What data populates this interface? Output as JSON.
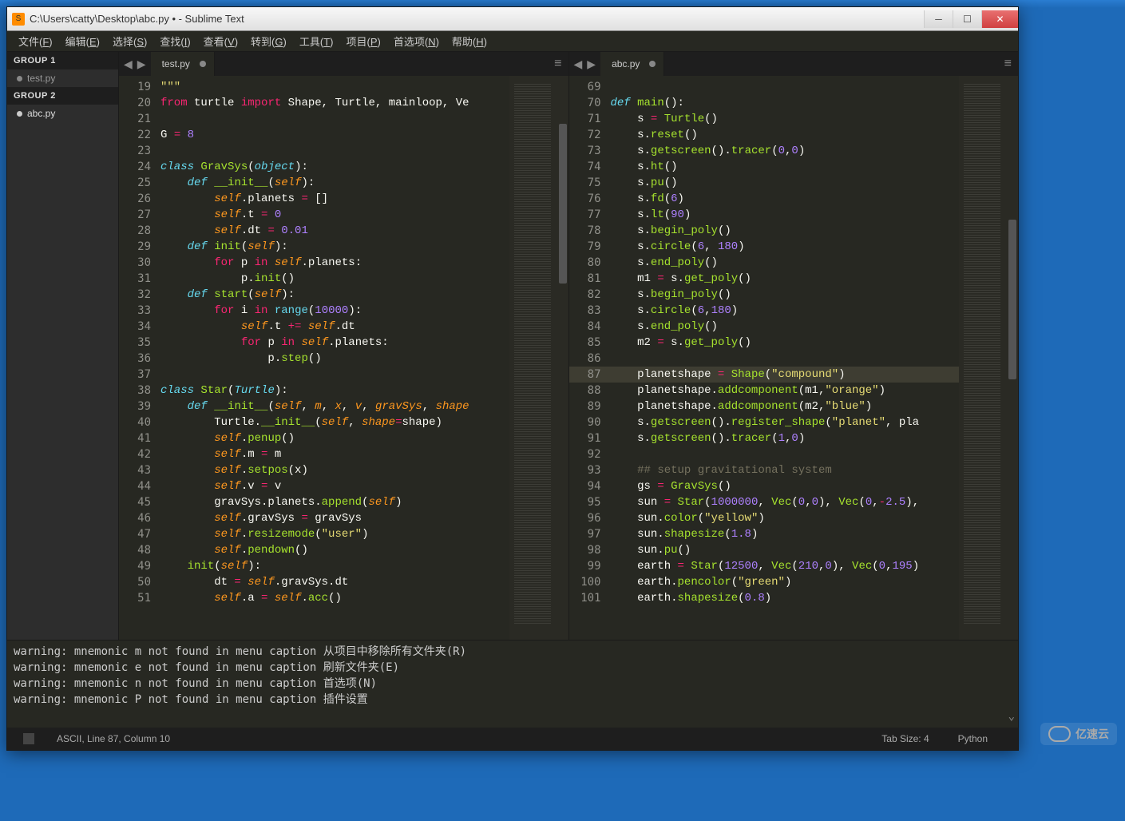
{
  "window": {
    "title": "C:\\Users\\catty\\Desktop\\abc.py • - Sublime Text"
  },
  "menubar": [
    {
      "label": "文件(F)",
      "u": "F"
    },
    {
      "label": "编辑(E)",
      "u": "E"
    },
    {
      "label": "选择(S)",
      "u": "S"
    },
    {
      "label": "查找(I)",
      "u": "I"
    },
    {
      "label": "查看(V)",
      "u": "V"
    },
    {
      "label": "转到(G)",
      "u": "G"
    },
    {
      "label": "工具(T)",
      "u": "T"
    },
    {
      "label": "项目(P)",
      "u": "P"
    },
    {
      "label": "首选项(N)",
      "u": "N"
    },
    {
      "label": "帮助(H)",
      "u": "H"
    }
  ],
  "sidebar": {
    "group1_label": "GROUP 1",
    "group2_label": "GROUP 2",
    "group1_files": [
      {
        "name": "test.py",
        "active": false
      }
    ],
    "group2_files": [
      {
        "name": "abc.py",
        "active": true
      }
    ]
  },
  "panes": [
    {
      "tab": "test.py",
      "first_line": 19,
      "highlight_line": null,
      "lines": [
        {
          "n": 19,
          "html": "<span class='str'>\"\"\"</span>"
        },
        {
          "n": 20,
          "html": "<span class='kw'>from</span> <span class='id'>turtle</span> <span class='kw'>import</span> <span class='id'>Shape, Turtle, mainloop, Ve</span>"
        },
        {
          "n": 21,
          "html": ""
        },
        {
          "n": 22,
          "html": "<span class='id'>G</span> <span class='op'>=</span> <span class='num'>8</span>"
        },
        {
          "n": 23,
          "html": ""
        },
        {
          "n": 24,
          "html": "<span class='kw2'>class</span> <span class='cls'>GravSys</span>(<span class='type'>object</span>):"
        },
        {
          "n": 25,
          "html": "    <span class='kw2'>def</span> <span class='fn'>__init__</span>(<span class='self'>self</span>):"
        },
        {
          "n": 26,
          "html": "        <span class='self'>self</span>.planets <span class='op'>=</span> []"
        },
        {
          "n": 27,
          "html": "        <span class='self'>self</span>.t <span class='op'>=</span> <span class='num'>0</span>"
        },
        {
          "n": 28,
          "html": "        <span class='self'>self</span>.dt <span class='op'>=</span> <span class='num'>0.01</span>"
        },
        {
          "n": 29,
          "html": "    <span class='kw2'>def</span> <span class='fn'>init</span>(<span class='self'>self</span>):"
        },
        {
          "n": 30,
          "html": "        <span class='kw'>for</span> p <span class='kw'>in</span> <span class='self'>self</span>.planets:"
        },
        {
          "n": 31,
          "html": "            p.<span class='fn'>init</span>()"
        },
        {
          "n": 32,
          "html": "    <span class='kw2'>def</span> <span class='fn'>start</span>(<span class='self'>self</span>):"
        },
        {
          "n": 33,
          "html": "        <span class='kw'>for</span> i <span class='kw'>in</span> <span class='builtin'>range</span>(<span class='num'>10000</span>):"
        },
        {
          "n": 34,
          "html": "            <span class='self'>self</span>.t <span class='op'>+=</span> <span class='self'>self</span>.dt"
        },
        {
          "n": 35,
          "html": "            <span class='kw'>for</span> p <span class='kw'>in</span> <span class='self'>self</span>.planets:"
        },
        {
          "n": 36,
          "html": "                p.<span class='fn'>step</span>()"
        },
        {
          "n": 37,
          "html": ""
        },
        {
          "n": 38,
          "html": "<span class='kw2'>class</span> <span class='cls'>Star</span>(<span class='type'>Turtle</span>):"
        },
        {
          "n": 39,
          "html": "    <span class='kw2'>def</span> <span class='fn'>__init__</span>(<span class='self'>self</span>, <span class='param'>m</span>, <span class='param'>x</span>, <span class='param'>v</span>, <span class='param'>gravSys</span>, <span class='param'>shape</span>"
        },
        {
          "n": 40,
          "html": "        Turtle.<span class='fn'>__init__</span>(<span class='self'>self</span>, <span class='param'>shape</span><span class='op'>=</span>shape)"
        },
        {
          "n": 41,
          "html": "        <span class='self'>self</span>.<span class='fn'>penup</span>()"
        },
        {
          "n": 42,
          "html": "        <span class='self'>self</span>.m <span class='op'>=</span> m"
        },
        {
          "n": 43,
          "html": "        <span class='self'>self</span>.<span class='fn'>setpos</span>(x)"
        },
        {
          "n": 44,
          "html": "        <span class='self'>self</span>.v <span class='op'>=</span> v"
        },
        {
          "n": 45,
          "html": "        gravSys.planets.<span class='fn'>append</span>(<span class='self'>self</span>)"
        },
        {
          "n": 46,
          "html": "        <span class='self'>self</span>.gravSys <span class='op'>=</span> gravSys"
        },
        {
          "n": 47,
          "html": "        <span class='self'>self</span>.<span class='fn'>resizemode</span>(<span class='str'>\"user\"</span>)"
        },
        {
          "n": 48,
          "html": "        <span class='self'>self</span>.<span class='fn'>pendown</span>()"
        },
        {
          "n": 49,
          "html": "    <span class='fn'>init</span>(<span class='self'>self</span>):"
        },
        {
          "n": 50,
          "html": "        dt <span class='op'>=</span> <span class='self'>self</span>.gravSys.dt"
        },
        {
          "n": 51,
          "html": "        <span class='self'>self</span>.a <span class='op'>=</span> <span class='self'>self</span>.<span class='fn'>acc</span>()"
        }
      ]
    },
    {
      "tab": "abc.py",
      "first_line": 69,
      "highlight_line": 87,
      "lines": [
        {
          "n": 69,
          "html": ""
        },
        {
          "n": 70,
          "html": "<span class='kw2'>def</span> <span class='fn'>main</span>():"
        },
        {
          "n": 71,
          "html": "    s <span class='op'>=</span> <span class='fn'>Turtle</span>()"
        },
        {
          "n": 72,
          "html": "    s.<span class='fn'>reset</span>()"
        },
        {
          "n": 73,
          "html": "    s.<span class='fn'>getscreen</span>().<span class='fn'>tracer</span>(<span class='num'>0</span>,<span class='num'>0</span>)"
        },
        {
          "n": 74,
          "html": "    s.<span class='fn'>ht</span>()"
        },
        {
          "n": 75,
          "html": "    s.<span class='fn'>pu</span>()"
        },
        {
          "n": 76,
          "html": "    s.<span class='fn'>fd</span>(<span class='num'>6</span>)"
        },
        {
          "n": 77,
          "html": "    s.<span class='fn'>lt</span>(<span class='num'>90</span>)"
        },
        {
          "n": 78,
          "html": "    s.<span class='fn'>begin_poly</span>()"
        },
        {
          "n": 79,
          "html": "    s.<span class='fn'>circle</span>(<span class='num'>6</span>, <span class='num'>180</span>)"
        },
        {
          "n": 80,
          "html": "    s.<span class='fn'>end_poly</span>()"
        },
        {
          "n": 81,
          "html": "    m1 <span class='op'>=</span> s.<span class='fn'>get_poly</span>()"
        },
        {
          "n": 82,
          "html": "    s.<span class='fn'>begin_poly</span>()"
        },
        {
          "n": 83,
          "html": "    s.<span class='fn'>circle</span>(<span class='num'>6</span>,<span class='num'>180</span>)"
        },
        {
          "n": 84,
          "html": "    s.<span class='fn'>end_poly</span>()"
        },
        {
          "n": 85,
          "html": "    m2 <span class='op'>=</span> s.<span class='fn'>get_poly</span>()"
        },
        {
          "n": 86,
          "html": ""
        },
        {
          "n": 87,
          "html": "    planetshape <span class='op'>=</span> <span class='fn'>Shape</span>(<span class='str'>\"compound\"</span>)"
        },
        {
          "n": 88,
          "html": "    planetshape.<span class='fn'>addcomponent</span>(m1,<span class='str'>\"orange\"</span>)"
        },
        {
          "n": 89,
          "html": "    planetshape.<span class='fn'>addcomponent</span>(m2,<span class='str'>\"blue\"</span>)"
        },
        {
          "n": 90,
          "html": "    s.<span class='fn'>getscreen</span>().<span class='fn'>register_shape</span>(<span class='str'>\"planet\"</span>, pla"
        },
        {
          "n": 91,
          "html": "    s.<span class='fn'>getscreen</span>().<span class='fn'>tracer</span>(<span class='num'>1</span>,<span class='num'>0</span>)"
        },
        {
          "n": 92,
          "html": ""
        },
        {
          "n": 93,
          "html": "    <span class='cm'>## setup gravitational system</span>"
        },
        {
          "n": 94,
          "html": "    gs <span class='op'>=</span> <span class='fn'>GravSys</span>()"
        },
        {
          "n": 95,
          "html": "    sun <span class='op'>=</span> <span class='fn'>Star</span>(<span class='num'>1000000</span>, <span class='fn'>Vec</span>(<span class='num'>0</span>,<span class='num'>0</span>), <span class='fn'>Vec</span>(<span class='num'>0</span>,<span class='op'>-</span><span class='num'>2.5</span>),"
        },
        {
          "n": 96,
          "html": "    sun.<span class='fn'>color</span>(<span class='str'>\"yellow\"</span>)"
        },
        {
          "n": 97,
          "html": "    sun.<span class='fn'>shapesize</span>(<span class='num'>1.8</span>)"
        },
        {
          "n": 98,
          "html": "    sun.<span class='fn'>pu</span>()"
        },
        {
          "n": 99,
          "html": "    earth <span class='op'>=</span> <span class='fn'>Star</span>(<span class='num'>12500</span>, <span class='fn'>Vec</span>(<span class='num'>210</span>,<span class='num'>0</span>), <span class='fn'>Vec</span>(<span class='num'>0</span>,<span class='num'>195</span>)"
        },
        {
          "n": 100,
          "html": "    earth.<span class='fn'>pencolor</span>(<span class='str'>\"green\"</span>)"
        },
        {
          "n": 101,
          "html": "    earth.<span class='fn'>shapesize</span>(<span class='num'>0.8</span>)"
        }
      ]
    }
  ],
  "console": [
    "warning: mnemonic m not found in menu caption 从项目中移除所有文件夹(R)",
    "warning: mnemonic e not found in menu caption 刷新文件夹(E)",
    "warning: mnemonic n not found in menu caption 首选项(N)",
    "warning: mnemonic P not found in menu caption 插件设置"
  ],
  "statusbar": {
    "left": "ASCII, Line 87, Column 10",
    "tab_size": "Tab Size: 4",
    "syntax": "Python"
  },
  "watermark": "亿速云"
}
